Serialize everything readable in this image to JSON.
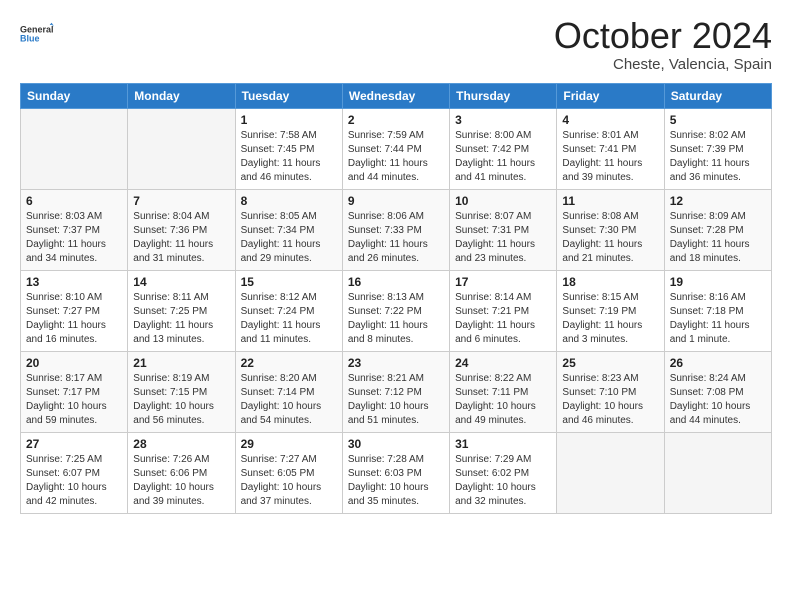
{
  "header": {
    "logo_general": "General",
    "logo_blue": "Blue",
    "month_title": "October 2024",
    "location": "Cheste, Valencia, Spain"
  },
  "weekdays": [
    "Sunday",
    "Monday",
    "Tuesday",
    "Wednesday",
    "Thursday",
    "Friday",
    "Saturday"
  ],
  "weeks": [
    [
      {
        "day": "",
        "info": ""
      },
      {
        "day": "",
        "info": ""
      },
      {
        "day": "1",
        "info": "Sunrise: 7:58 AM\nSunset: 7:45 PM\nDaylight: 11 hours and 46 minutes."
      },
      {
        "day": "2",
        "info": "Sunrise: 7:59 AM\nSunset: 7:44 PM\nDaylight: 11 hours and 44 minutes."
      },
      {
        "day": "3",
        "info": "Sunrise: 8:00 AM\nSunset: 7:42 PM\nDaylight: 11 hours and 41 minutes."
      },
      {
        "day": "4",
        "info": "Sunrise: 8:01 AM\nSunset: 7:41 PM\nDaylight: 11 hours and 39 minutes."
      },
      {
        "day": "5",
        "info": "Sunrise: 8:02 AM\nSunset: 7:39 PM\nDaylight: 11 hours and 36 minutes."
      }
    ],
    [
      {
        "day": "6",
        "info": "Sunrise: 8:03 AM\nSunset: 7:37 PM\nDaylight: 11 hours and 34 minutes."
      },
      {
        "day": "7",
        "info": "Sunrise: 8:04 AM\nSunset: 7:36 PM\nDaylight: 11 hours and 31 minutes."
      },
      {
        "day": "8",
        "info": "Sunrise: 8:05 AM\nSunset: 7:34 PM\nDaylight: 11 hours and 29 minutes."
      },
      {
        "day": "9",
        "info": "Sunrise: 8:06 AM\nSunset: 7:33 PM\nDaylight: 11 hours and 26 minutes."
      },
      {
        "day": "10",
        "info": "Sunrise: 8:07 AM\nSunset: 7:31 PM\nDaylight: 11 hours and 23 minutes."
      },
      {
        "day": "11",
        "info": "Sunrise: 8:08 AM\nSunset: 7:30 PM\nDaylight: 11 hours and 21 minutes."
      },
      {
        "day": "12",
        "info": "Sunrise: 8:09 AM\nSunset: 7:28 PM\nDaylight: 11 hours and 18 minutes."
      }
    ],
    [
      {
        "day": "13",
        "info": "Sunrise: 8:10 AM\nSunset: 7:27 PM\nDaylight: 11 hours and 16 minutes."
      },
      {
        "day": "14",
        "info": "Sunrise: 8:11 AM\nSunset: 7:25 PM\nDaylight: 11 hours and 13 minutes."
      },
      {
        "day": "15",
        "info": "Sunrise: 8:12 AM\nSunset: 7:24 PM\nDaylight: 11 hours and 11 minutes."
      },
      {
        "day": "16",
        "info": "Sunrise: 8:13 AM\nSunset: 7:22 PM\nDaylight: 11 hours and 8 minutes."
      },
      {
        "day": "17",
        "info": "Sunrise: 8:14 AM\nSunset: 7:21 PM\nDaylight: 11 hours and 6 minutes."
      },
      {
        "day": "18",
        "info": "Sunrise: 8:15 AM\nSunset: 7:19 PM\nDaylight: 11 hours and 3 minutes."
      },
      {
        "day": "19",
        "info": "Sunrise: 8:16 AM\nSunset: 7:18 PM\nDaylight: 11 hours and 1 minute."
      }
    ],
    [
      {
        "day": "20",
        "info": "Sunrise: 8:17 AM\nSunset: 7:17 PM\nDaylight: 10 hours and 59 minutes."
      },
      {
        "day": "21",
        "info": "Sunrise: 8:19 AM\nSunset: 7:15 PM\nDaylight: 10 hours and 56 minutes."
      },
      {
        "day": "22",
        "info": "Sunrise: 8:20 AM\nSunset: 7:14 PM\nDaylight: 10 hours and 54 minutes."
      },
      {
        "day": "23",
        "info": "Sunrise: 8:21 AM\nSunset: 7:12 PM\nDaylight: 10 hours and 51 minutes."
      },
      {
        "day": "24",
        "info": "Sunrise: 8:22 AM\nSunset: 7:11 PM\nDaylight: 10 hours and 49 minutes."
      },
      {
        "day": "25",
        "info": "Sunrise: 8:23 AM\nSunset: 7:10 PM\nDaylight: 10 hours and 46 minutes."
      },
      {
        "day": "26",
        "info": "Sunrise: 8:24 AM\nSunset: 7:08 PM\nDaylight: 10 hours and 44 minutes."
      }
    ],
    [
      {
        "day": "27",
        "info": "Sunrise: 7:25 AM\nSunset: 6:07 PM\nDaylight: 10 hours and 42 minutes."
      },
      {
        "day": "28",
        "info": "Sunrise: 7:26 AM\nSunset: 6:06 PM\nDaylight: 10 hours and 39 minutes."
      },
      {
        "day": "29",
        "info": "Sunrise: 7:27 AM\nSunset: 6:05 PM\nDaylight: 10 hours and 37 minutes."
      },
      {
        "day": "30",
        "info": "Sunrise: 7:28 AM\nSunset: 6:03 PM\nDaylight: 10 hours and 35 minutes."
      },
      {
        "day": "31",
        "info": "Sunrise: 7:29 AM\nSunset: 6:02 PM\nDaylight: 10 hours and 32 minutes."
      },
      {
        "day": "",
        "info": ""
      },
      {
        "day": "",
        "info": ""
      }
    ]
  ]
}
